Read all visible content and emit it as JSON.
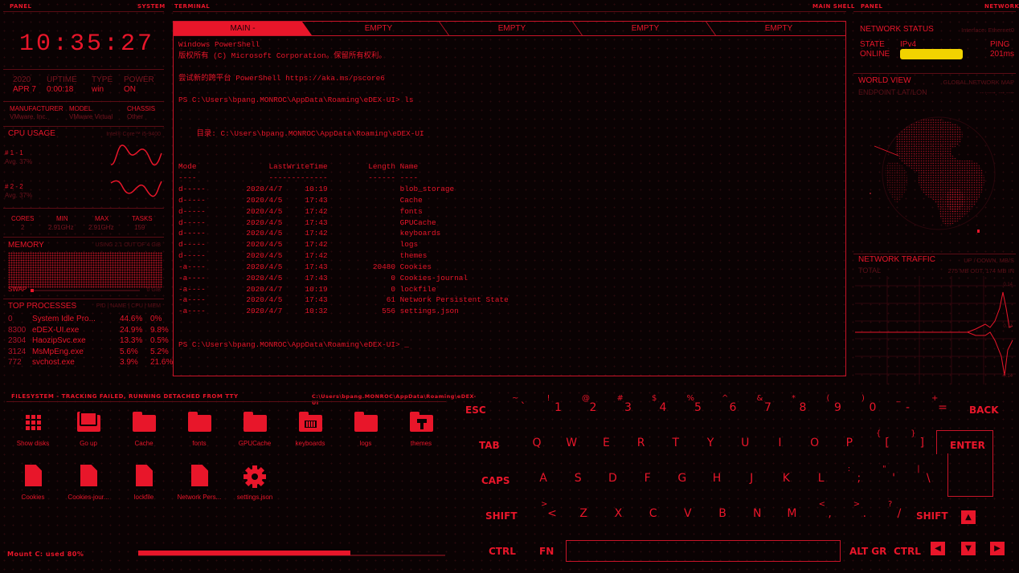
{
  "headers": {
    "panel_left": "PANEL",
    "system": "SYSTEM",
    "terminal": "TERMINAL",
    "main_shell": "MAIN SHELL",
    "panel_right": "PANEL",
    "network": "NETWORK"
  },
  "clock": "10:35:27",
  "system": {
    "labels": [
      "2020",
      "UPTIME",
      "TYPE",
      "POWER"
    ],
    "values": [
      "APR 7",
      "0:00:18",
      "win",
      "ON"
    ],
    "hw_labels": [
      "MANUFACTURER",
      "MODEL",
      "CHASSIS"
    ],
    "hw_values": [
      "VMware, Inc.",
      "VMware Virtual",
      "Other"
    ]
  },
  "cpu": {
    "title": "CPU USAGE",
    "model": "Intel® Core™ i5-9400",
    "cores": [
      {
        "label": "# 1 - 1",
        "avg": "Avg. 37%"
      },
      {
        "label": "# 2 - 2",
        "avg": "Avg. 37%"
      }
    ],
    "stat_labels": [
      "CORES",
      "MIN",
      "MAX",
      "TASKS"
    ],
    "stat_values": [
      "2",
      "2.91GHz",
      "2.91GHz",
      "159"
    ]
  },
  "memory": {
    "title": "MEMORY",
    "usage": "USING 2.1 OUT OF 4 GiB",
    "swap_label": "SWAP",
    "swap_value": "0 GiB",
    "swap_fill": 0.02
  },
  "processes": {
    "title": "TOP PROCESSES",
    "header": "PID | NAME | CPU | MEM",
    "rows": [
      {
        "pid": "0",
        "name": "System Idle Pro...",
        "cpu": "44.6%",
        "mem": "0%"
      },
      {
        "pid": "8300",
        "name": "eDEX-UI.exe",
        "cpu": "24.9%",
        "mem": "9.8%"
      },
      {
        "pid": "2304",
        "name": "HaozipSvc.exe",
        "cpu": "13.3%",
        "mem": "0.5%"
      },
      {
        "pid": "3124",
        "name": "MsMpEng.exe",
        "cpu": "5.6%",
        "mem": "5.2%"
      },
      {
        "pid": "772",
        "name": "svchost.exe",
        "cpu": "3.9%",
        "mem": "21.6%"
      }
    ]
  },
  "terminal": {
    "tabs": [
      "MAIN -",
      "EMPTY",
      "EMPTY",
      "EMPTY",
      "EMPTY"
    ],
    "lines": [
      "Windows PowerShell",
      "版权所有 (C) Microsoft Corporation。保留所有权利。",
      "",
      "尝试新的跨平台 PowerShell https://aka.ms/pscore6",
      "",
      "PS C:\\Users\\bpang.MONROC\\AppData\\Roaming\\eDEX-UI> ls",
      "",
      "",
      "    目录: C:\\Users\\bpang.MONROC\\AppData\\Roaming\\eDEX-UI",
      "",
      "",
      "Mode                LastWriteTime         Length Name",
      "----                -------------         ------ ----",
      "d-----         2020/4/7     10:19                blob_storage",
      "d-----         2020/4/5     17:43                Cache",
      "d-----         2020/4/5     17:42                fonts",
      "d-----         2020/4/5     17:43                GPUCache",
      "d-----         2020/4/5     17:42                keyboards",
      "d-----         2020/4/5     17:42                logs",
      "d-----         2020/4/5     17:42                themes",
      "-a----         2020/4/5     17:43          20480 Cookies",
      "-a----         2020/4/5     17:43              0 Cookies-journal",
      "-a----         2020/4/7     10:19              0 lockfile",
      "-a----         2020/4/5     17:43             61 Network Persistent State",
      "-a----         2020/4/7     10:32            556 settings.json",
      "",
      "",
      "PS C:\\Users\\bpang.MONROC\\AppData\\Roaming\\eDEX-UI> _"
    ]
  },
  "network": {
    "status_title": "NETWORK STATUS",
    "interface": "Interface: Ethernet0",
    "labels": [
      "STATE",
      "IPv4",
      "PING"
    ],
    "values": [
      "ONLINE",
      "",
      "201ms"
    ],
    "world_title": "WORLD VIEW",
    "world_sub": "GLOBAL NETWORK MAP",
    "endpoint": "ENDPOINT LAT/LON",
    "endpoint_val": "-- .----, ---.----",
    "traffic_title": "NETWORK TRAFFIC",
    "traffic_sub": "UP / DOWN, MB/S",
    "traffic_total": "TOTAL",
    "traffic_total_val": "275 MB OUT, 174 MB IN",
    "traffic_scale_top": "0.14",
    "traffic_scale_mid": "0.14",
    "traffic_scale_bot": "-0.14"
  },
  "filesystem": {
    "title": "FILESYSTEM - TRACKING FAILED, RUNNING DETACHED FROM TTY",
    "path": "C:\\Users\\bpang.MONROC\\AppData\\Roaming\\eDEX-UI",
    "items": [
      {
        "label": "Show disks",
        "icon": "grid-icon"
      },
      {
        "label": "Go up",
        "icon": "go-up-icon"
      },
      {
        "label": "Cache",
        "icon": "folder-icon"
      },
      {
        "label": "fonts",
        "icon": "folder-icon"
      },
      {
        "label": "GPUCache",
        "icon": "folder-icon"
      },
      {
        "label": "keyboards",
        "icon": "keyboard-folder-icon"
      },
      {
        "label": "logs",
        "icon": "folder-icon"
      },
      {
        "label": "themes",
        "icon": "theme-folder-icon"
      },
      {
        "label": "Cookies",
        "icon": "file-icon"
      },
      {
        "label": "Cookies-jour...",
        "icon": "file-icon"
      },
      {
        "label": "lockfile",
        "icon": "file-icon"
      },
      {
        "label": "Network Pers...",
        "icon": "file-icon"
      },
      {
        "label": "settings.json",
        "icon": "gear-icon"
      }
    ],
    "mount_label": "Mount C: used 80%",
    "mount_fill": 0.8
  },
  "keyboard": {
    "esc": "ESC",
    "back": "BACK",
    "tab": "TAB",
    "enter": "ENTER",
    "caps": "CAPS",
    "shift_l": "SHIFT",
    "shift_r": "SHIFT",
    "ctrl_l": "CTRL",
    "fn": "FN",
    "altgr": "ALT GR",
    "ctrl_r": "CTRL",
    "row1": [
      [
        "~",
        "`"
      ],
      [
        "!",
        "1"
      ],
      [
        "@",
        "2"
      ],
      [
        "#",
        "3"
      ],
      [
        "$",
        "4"
      ],
      [
        "%",
        "5"
      ],
      [
        "^",
        "6"
      ],
      [
        "&",
        "7"
      ],
      [
        "*",
        "8"
      ],
      [
        "(",
        "9"
      ],
      [
        ")",
        "0"
      ],
      [
        "_",
        "-"
      ],
      [
        "+",
        "="
      ]
    ],
    "row2": [
      "Q",
      "W",
      "E",
      "R",
      "T",
      "Y",
      "U",
      "I",
      "O",
      "P",
      [
        "{",
        "["
      ],
      [
        "}",
        "]"
      ]
    ],
    "row3": [
      "A",
      "S",
      "D",
      "F",
      "G",
      "H",
      "J",
      "K",
      "L",
      [
        ":",
        ";"
      ],
      [
        "\"",
        "'"
      ],
      [
        "|",
        "\\"
      ]
    ],
    "row4": [
      [
        ">",
        "<"
      ],
      "Z",
      "X",
      "C",
      "V",
      "B",
      "N",
      "M",
      [
        "<",
        ","
      ],
      [
        ">",
        "."
      ],
      [
        "?",
        "/"
      ]
    ],
    "arrows": [
      "▲",
      "◀",
      "▼",
      "▶"
    ]
  }
}
